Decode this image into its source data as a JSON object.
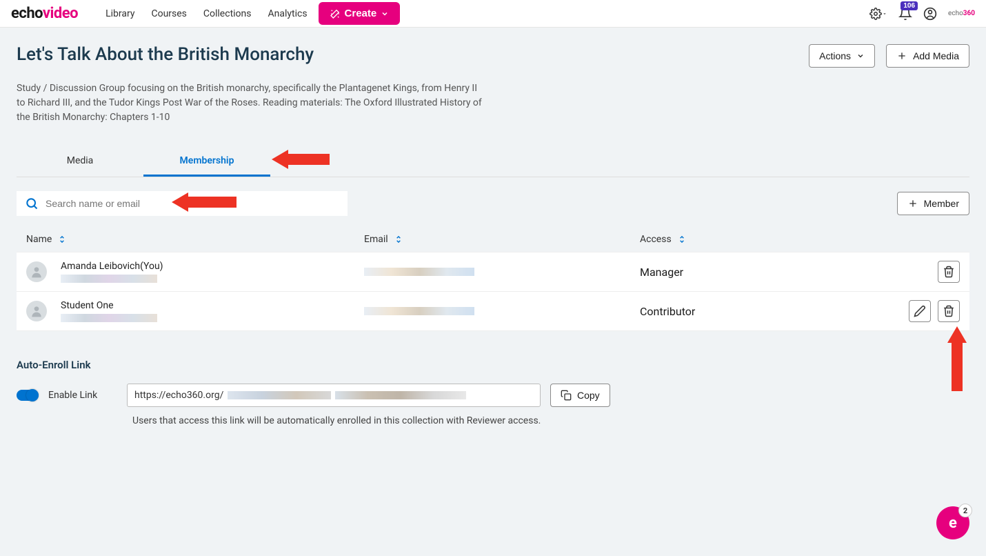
{
  "logo": {
    "part1": "echo",
    "part2": "video"
  },
  "nav": {
    "library": "Library",
    "courses": "Courses",
    "collections": "Collections",
    "analytics": "Analytics"
  },
  "create_label": "Create",
  "notification_count": "106",
  "page": {
    "title": "Let's Talk About the British Monarchy",
    "description": "Study / Discussion Group focusing on the British monarchy, specifically the Plantagenet Kings, from Henry II to Richard III, and the Tudor Kings Post War of the Roses. Reading materials: The Oxford Illustrated History of the British Monarchy: Chapters 1-10",
    "actions_label": "Actions",
    "add_media_label": "Add Media"
  },
  "tabs": {
    "media": "Media",
    "membership": "Membership"
  },
  "search": {
    "placeholder": "Search name or email"
  },
  "member_button": "Member",
  "columns": {
    "name": "Name",
    "email": "Email",
    "access": "Access"
  },
  "members": [
    {
      "name": "Amanda Leibovich(You)",
      "access": "Manager"
    },
    {
      "name": "Student One",
      "access": "Contributor"
    }
  ],
  "auto_enroll": {
    "title": "Auto-Enroll Link",
    "enable_label": "Enable Link",
    "link_prefix": "https://echo360.org/",
    "copy_label": "Copy",
    "hint": "Users that access this link will be automatically enrolled in this collection with Reviewer access."
  },
  "fab_badge": "2"
}
